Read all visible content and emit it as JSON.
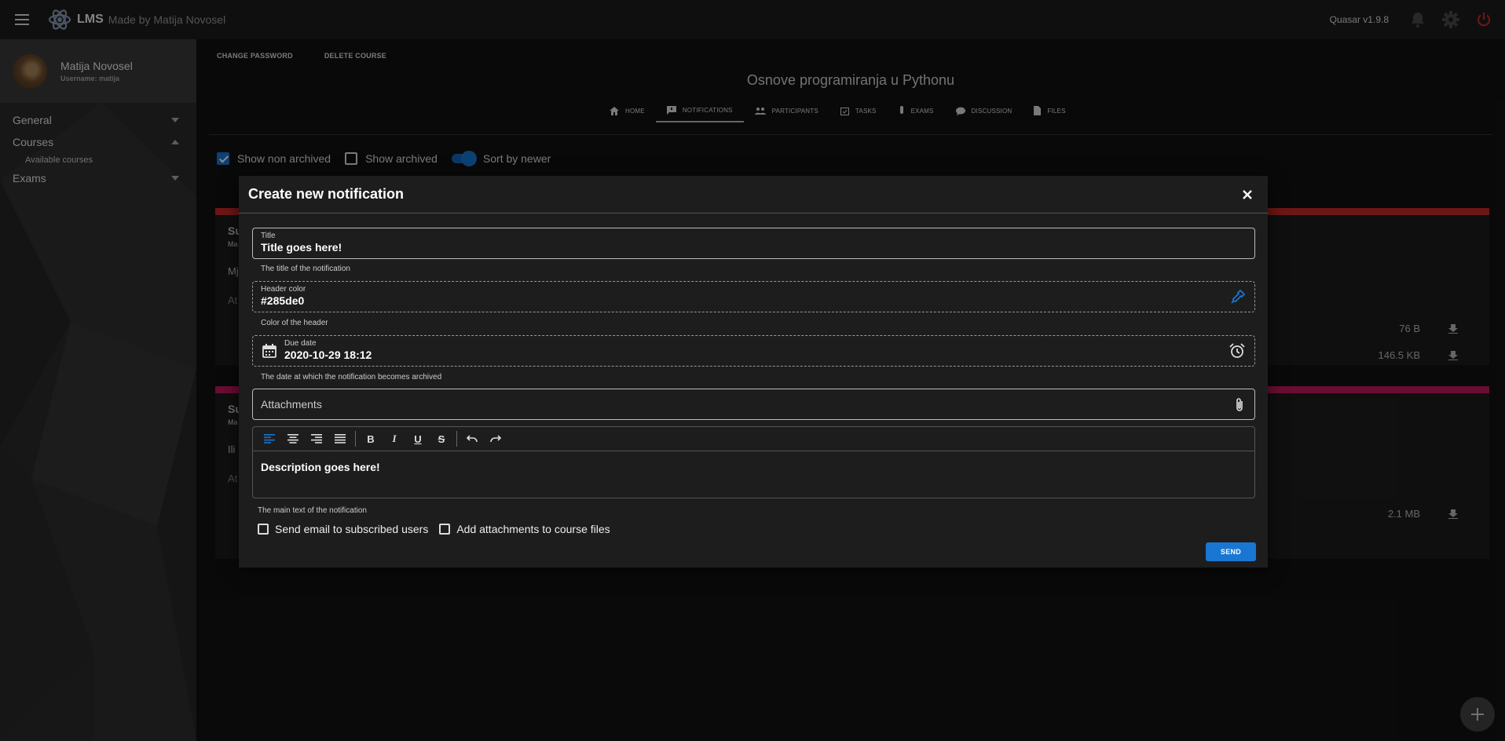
{
  "header": {
    "app_name": "LMS",
    "tagline": "Made by Matija Novosel",
    "version": "Quasar v1.9.8",
    "icons": [
      "menu-icon",
      "atom-logo-icon",
      "bell-icon",
      "gear-icon",
      "power-icon"
    ]
  },
  "sidebar": {
    "user_name": "Matija Novosel",
    "username_line": "Username: matija",
    "items": [
      {
        "label": "General",
        "expanded": false
      },
      {
        "label": "Courses",
        "expanded": true,
        "children": [
          "Available courses"
        ]
      },
      {
        "label": "Exams",
        "expanded": false
      }
    ]
  },
  "main": {
    "actions": [
      "CHANGE PASSWORD",
      "DELETE COURSE"
    ],
    "course_title": "Osnove programiranja u Pythonu",
    "tabs": [
      {
        "label": "HOME",
        "icon": "home-icon"
      },
      {
        "label": "NOTIFICATIONS",
        "icon": "announcement-icon",
        "active": true
      },
      {
        "label": "PARTICIPANTS",
        "icon": "people-icon"
      },
      {
        "label": "TASKS",
        "icon": "calendar-check-icon"
      },
      {
        "label": "EXAMS",
        "icon": "test-tube-icon"
      },
      {
        "label": "DISCUSSION",
        "icon": "chat-icon"
      },
      {
        "label": "FILES",
        "icon": "file-icon"
      }
    ],
    "filters": {
      "non_archived": "Show non archived",
      "archived": "Show archived",
      "sort": "Sort by newer"
    },
    "cards": [
      {
        "title_frag": "Su",
        "sub_frag": "Ma",
        "row_frag": "Mj",
        "att_frag": "At",
        "color": "#c62828",
        "files": [
          "76 B",
          "146.5 KB"
        ]
      },
      {
        "title_frag": "Su",
        "sub_frag": "Ma",
        "row_frag": "Ili",
        "att_frag": "At",
        "color": "#c2185b",
        "files": [
          "2.1 MB"
        ]
      }
    ]
  },
  "dialog": {
    "title": "Create new notification",
    "title_field": {
      "label": "Title",
      "value": "Title goes here!",
      "hint": "The title of the notification"
    },
    "color_field": {
      "label": "Header color",
      "value": "#285de0",
      "hint": "Color of the header"
    },
    "date_field": {
      "label": "Due date",
      "value": "2020-10-29 18:12",
      "hint": "The date at which the notification becomes archived"
    },
    "attachments_label": "Attachments",
    "editor_content": "Description goes here!",
    "editor_hint": "The main text of the notification",
    "send_email_label": "Send email to subscribed users",
    "add_attachments_label": "Add attachments to course files",
    "send_label": "SEND",
    "accent": "#1976d2"
  }
}
